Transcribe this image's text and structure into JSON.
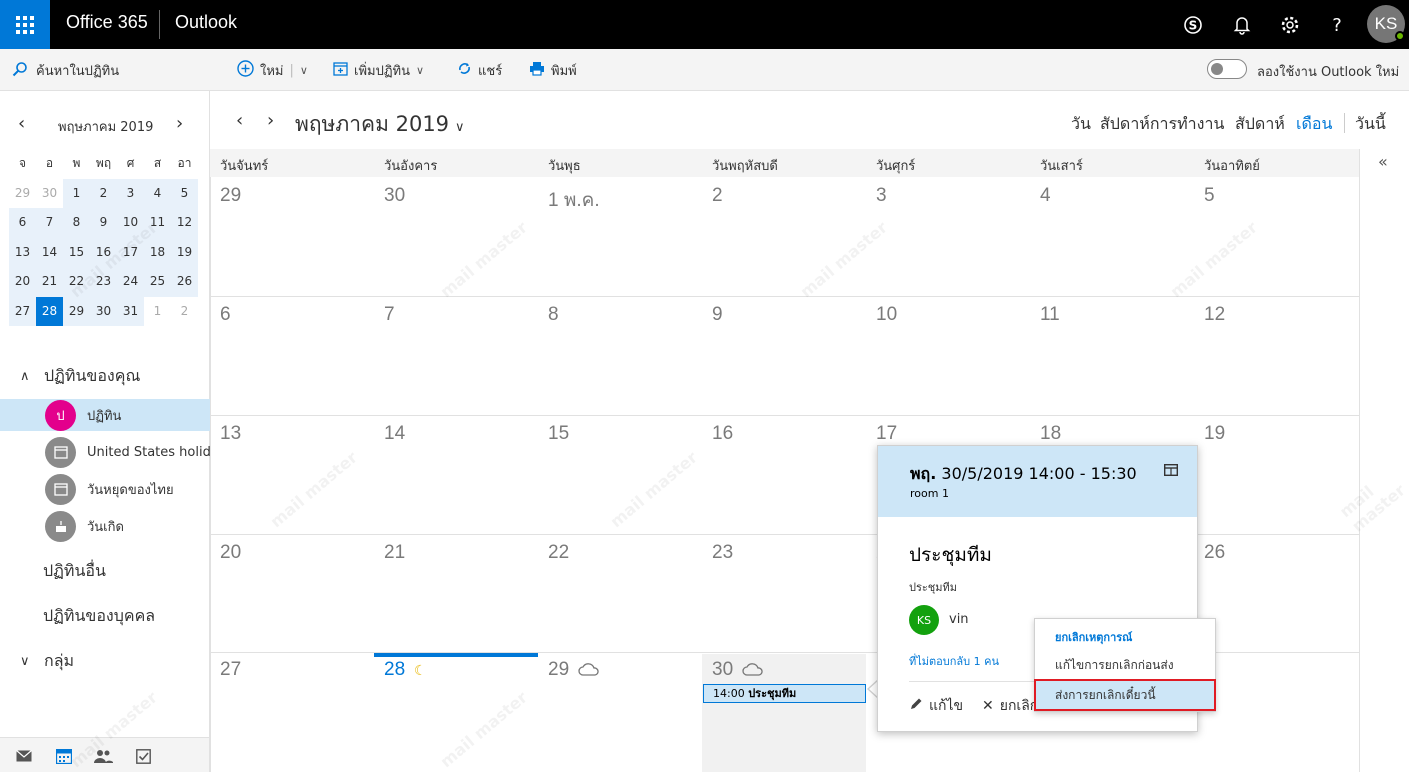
{
  "topbar": {
    "brand": "Office 365",
    "app": "Outlook",
    "avatar_initials": "KS",
    "icons": [
      "skype-icon",
      "bell-icon",
      "gear-icon",
      "help-icon"
    ]
  },
  "commandbar": {
    "search_placeholder": "ค้นหาในปฏิทิน",
    "new_label": "ใหม่",
    "add_calendar_label": "เพิ่มปฏิทิน",
    "share_label": "แชร์",
    "print_label": "พิมพ์",
    "try_new_label": "ลองใช้งาน Outlook ใหม่"
  },
  "mini_calendar": {
    "title": "พฤษภาคม 2019",
    "weekdays": [
      "จ",
      "อ",
      "พ",
      "พฤ",
      "ศ",
      "ส",
      "อา"
    ],
    "weeks": [
      [
        "29",
        "30",
        "1",
        "2",
        "3",
        "4",
        "5"
      ],
      [
        "6",
        "7",
        "8",
        "9",
        "10",
        "11",
        "12"
      ],
      [
        "13",
        "14",
        "15",
        "16",
        "17",
        "18",
        "19"
      ],
      [
        "20",
        "21",
        "22",
        "23",
        "24",
        "25",
        "26"
      ],
      [
        "27",
        "28",
        "29",
        "30",
        "31",
        "1",
        "2"
      ]
    ],
    "today": "28"
  },
  "sidebar": {
    "your_calendars": "ปฏิทินของคุณ",
    "calendars": [
      {
        "initial": "ป",
        "name": "ปฏิทิน",
        "color": "#e3008c"
      },
      {
        "initial": "",
        "name": "United States holidays",
        "color": "#8a8a8a"
      },
      {
        "initial": "",
        "name": "วันหยุดของไทย",
        "color": "#8a8a8a"
      },
      {
        "initial": "",
        "name": "วันเกิด",
        "color": "#8a8a8a"
      }
    ],
    "other_calendars": "ปฏิทินอื่น",
    "people_calendars": "ปฏิทินของบุคคล",
    "groups": "กลุ่ม"
  },
  "main": {
    "month_title": "พฤษภาคม 2019",
    "views": [
      "วัน",
      "สัปดาห์การทำงาน",
      "สัปดาห์",
      "เดือน"
    ],
    "active_view": "เดือน",
    "today_label": "วันนี้",
    "weekdays": [
      "วันจันทร์",
      "วันอังคาร",
      "วันพุธ",
      "วันพฤหัสบดี",
      "วันศุกร์",
      "วันเสาร์",
      "วันอาทิตย์"
    ],
    "weeks": [
      [
        "29",
        "30",
        "1 พ.ค.",
        "2",
        "3",
        "4",
        "5"
      ],
      [
        "6",
        "7",
        "8",
        "9",
        "10",
        "11",
        "12"
      ],
      [
        "13",
        "14",
        "15",
        "16",
        "17",
        "18",
        "19"
      ],
      [
        "20",
        "21",
        "22",
        "23",
        "24",
        "25",
        "26"
      ],
      [
        "27",
        "28",
        "29",
        "30",
        "",
        "",
        ""
      ]
    ],
    "event": {
      "time": "14:00",
      "title": "ประชุมทีม"
    }
  },
  "peek": {
    "day": "พฤ.",
    "datetime": "30/5/2019 14:00 - 15:30",
    "location": "room 1",
    "title": "ประชุมทีม",
    "description": "ประชุมทีม",
    "organizer_initials": "KS",
    "organizer_name": "vin",
    "no_reply": "ที่ไม่ตอบกลับ 1 คน",
    "edit_label": "แก้ไข",
    "cancel_label": "ยกเลิก"
  },
  "cancel_menu": {
    "header": "ยกเลิกเหตุการณ์",
    "items": [
      "แก้ไขการยกเลิกก่อนส่ง",
      "ส่งการยกเลิกเดี๋ยวนี้"
    ]
  },
  "watermark": "mail master"
}
